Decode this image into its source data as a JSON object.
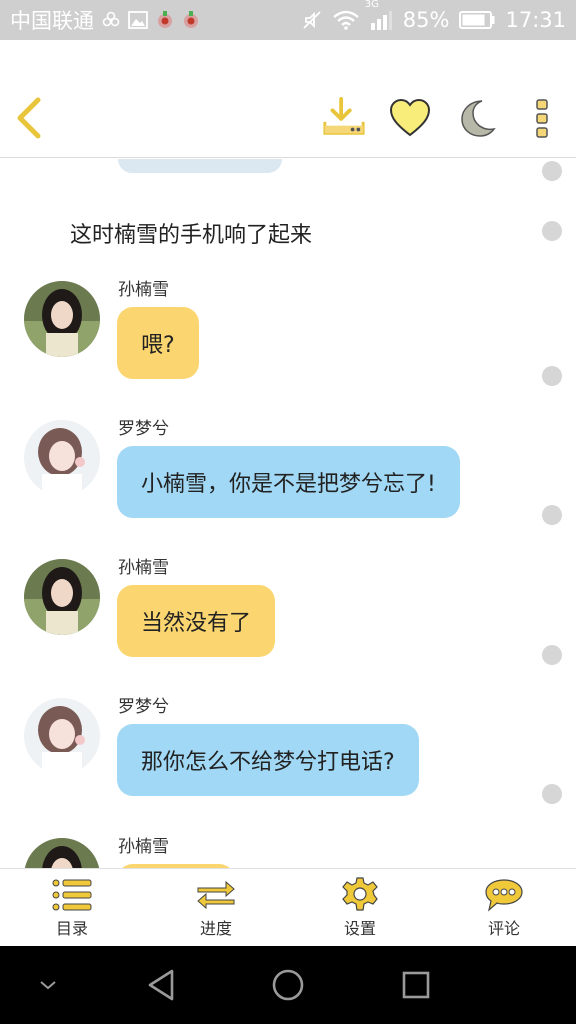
{
  "status_bar": {
    "carrier": "中国联通",
    "network": "3G",
    "battery": "85%",
    "time": "17:31"
  },
  "app_bar": {
    "icons": [
      "back-chevron-icon",
      "download-icon",
      "heart-icon",
      "moon-icon",
      "more-vertical-icon"
    ]
  },
  "chat": {
    "narration": "这时楠雪的手机响了起来",
    "messages": [
      {
        "sender": "孙楠雪",
        "text": "喂?",
        "color": "yellow",
        "avatar": "avatar-sun-nanxue"
      },
      {
        "sender": "罗梦兮",
        "text": "小楠雪，你是不是把梦兮忘了!",
        "color": "blue",
        "avatar": "avatar-luo-mengxi"
      },
      {
        "sender": "孙楠雪",
        "text": "当然没有了",
        "color": "yellow",
        "avatar": "avatar-sun-nanxue"
      },
      {
        "sender": "罗梦兮",
        "text": "那你怎么不给梦兮打电话?",
        "color": "blue",
        "avatar": "avatar-luo-mengxi"
      },
      {
        "sender": "孙楠雪",
        "text": "",
        "color": "yellow",
        "avatar": "avatar-sun-nanxue"
      }
    ]
  },
  "toolbar": {
    "items": [
      {
        "label": "目录",
        "icon": "list-icon"
      },
      {
        "label": "进度",
        "icon": "swap-arrows-icon"
      },
      {
        "label": "设置",
        "icon": "gear-icon"
      },
      {
        "label": "评论",
        "icon": "comment-icon"
      }
    ]
  },
  "colors": {
    "accent": "#f5c93d",
    "yellow_bubble": "#fbd670",
    "blue_bubble": "#a1d8f5",
    "status_bar_bg": "#cfcfcf"
  }
}
